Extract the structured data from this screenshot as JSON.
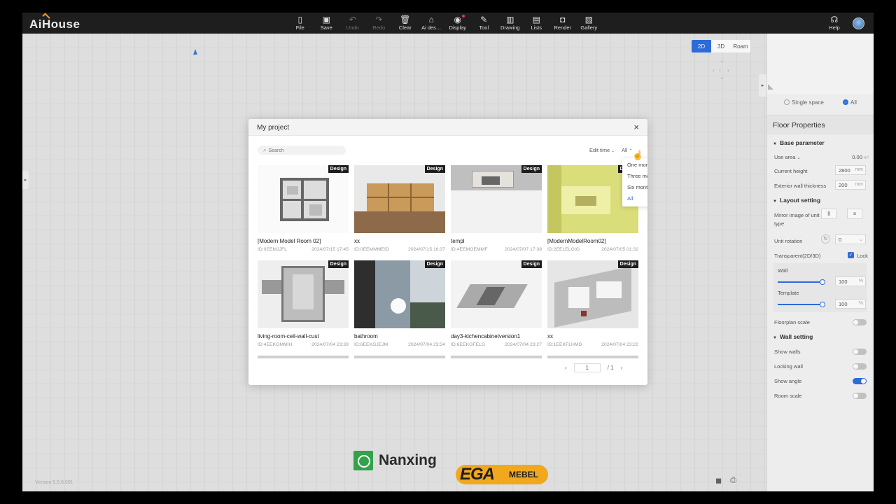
{
  "app": {
    "logo": "AiHouse"
  },
  "toolbar": [
    {
      "label": "File",
      "icon": "▯",
      "name": "file",
      "disabled": false,
      "dot": false
    },
    {
      "label": "Save",
      "icon": "▣",
      "name": "save",
      "disabled": false,
      "dot": false
    },
    {
      "label": "Undo",
      "icon": "↶",
      "name": "undo",
      "disabled": true,
      "dot": false
    },
    {
      "label": "Redo",
      "icon": "↷",
      "name": "redo",
      "disabled": true,
      "dot": false
    },
    {
      "label": "Clear",
      "icon": "🗑",
      "name": "clear",
      "disabled": false,
      "dot": false
    },
    {
      "label": "Ai des…",
      "icon": "⌂",
      "name": "ai-design",
      "disabled": false,
      "dot": false
    },
    {
      "label": "Display",
      "icon": "◉",
      "name": "display",
      "disabled": false,
      "dot": true
    },
    {
      "label": "Tool",
      "icon": "✎",
      "name": "tool",
      "disabled": false,
      "dot": false
    },
    {
      "label": "Drawing",
      "icon": "▥",
      "name": "drawing",
      "disabled": false,
      "dot": false
    },
    {
      "label": "Lists",
      "icon": "▤",
      "name": "lists",
      "disabled": false,
      "dot": false
    },
    {
      "label": "Render",
      "icon": "◘",
      "name": "render",
      "disabled": false,
      "dot": false
    },
    {
      "label": "Gallery",
      "icon": "▨",
      "name": "gallery",
      "disabled": false,
      "dot": false
    }
  ],
  "help": {
    "label": "Help",
    "icon": "☊"
  },
  "viewmodes": [
    "2D",
    "3D",
    "Roam"
  ],
  "version": "Version 5.5.0.001",
  "scope": {
    "single": "Single space",
    "all": "All"
  },
  "floor": {
    "title": "Floor Properties",
    "base_parameter": "Base parameter",
    "use_area": "Use area",
    "use_area_value": "0.00",
    "use_area_unit": "m²",
    "current_height": "Current height",
    "current_height_value": "2800",
    "ext_wall": "Exterior wall thickness",
    "ext_wall_value": "200",
    "unit_mm": "mm",
    "layout_setting": "Layout setting",
    "mirror": "Mirror image of unit type",
    "unit_rotation": "Unit rotation",
    "unit_rotation_value": "0",
    "transparent": "Transparent(2D/3D)",
    "lock": "Lock",
    "wall": "Wall",
    "wall_value": "100",
    "template": "Template",
    "template_value": "100",
    "floorplan_scale": "Floorplan scale",
    "wall_setting": "Wall setting",
    "show_walls": "Show walls",
    "locking_wall": "Locking wall",
    "show_angle": "Show angle",
    "room_scale": "Room scale"
  },
  "modal": {
    "title": "My project",
    "search_placeholder": "Search",
    "sort_label": "Edit time",
    "range_label": "All",
    "range_options": [
      "One month",
      "Three months",
      "Six months",
      "All"
    ],
    "badge": "Design",
    "projects": [
      {
        "name": "[Modern Model Room 02]",
        "id": "ID:0EEMJJFL",
        "date": "2024/07/15 17:45"
      },
      {
        "name": "xx",
        "id": "ID:0EEMMMEID",
        "date": "2024/07/15 16:37"
      },
      {
        "name": "templ",
        "id": "ID:4EEMGEMMF",
        "date": "2024/07/07 17:38"
      },
      {
        "name": "[ModernModelRoom02]",
        "id": "ID:2EELELGIG",
        "date": "2024/07/05 01:32"
      },
      {
        "name": "living-room-ceil-wall-cust",
        "id": "ID:4EEKGMMIH",
        "date": "2024/07/04 23:39"
      },
      {
        "name": "bathroom",
        "id": "ID:6EEKGJEJM",
        "date": "2024/07/04 23:34"
      },
      {
        "name": "day3-kichencabinetversion1",
        "id": "ID:6EEKGFELG",
        "date": "2024/07/04 23:27"
      },
      {
        "name": "xx",
        "id": "ID:1EEKFLHMD",
        "date": "2024/07/04 23:22"
      }
    ],
    "page": "1",
    "total_pages": "1"
  },
  "brand": {
    "nanxing": "Nanxing",
    "ega": "EGA",
    "mebel": "MEBEL"
  },
  "colors": {
    "accent": "#2f6fe0",
    "topbar": "#1f1f1f",
    "badge": "#1c1c1c"
  }
}
